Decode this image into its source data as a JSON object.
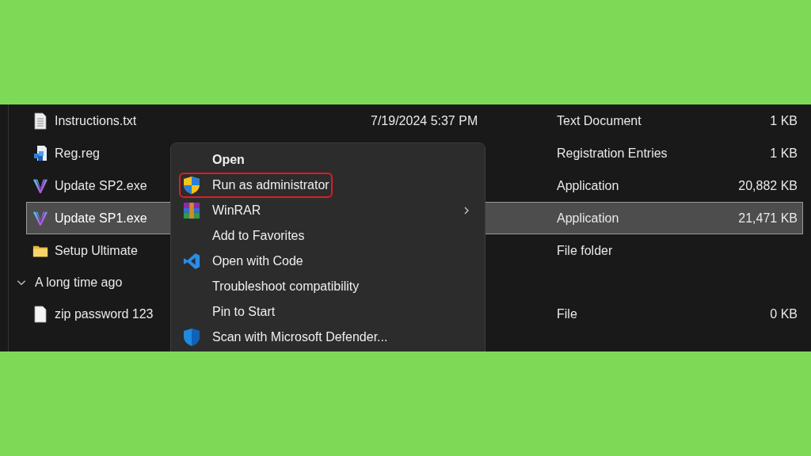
{
  "file_list": {
    "rows": [
      {
        "kind": "document",
        "name": "Instructions.txt",
        "date": "7/19/2024 5:37 PM",
        "type": "Text Document",
        "size": "1 KB",
        "selected": false
      },
      {
        "kind": "registry",
        "name": "Reg.reg",
        "type": "Registration Entries",
        "size": "1 KB",
        "selected": false
      },
      {
        "kind": "application",
        "name": "Update SP2.exe",
        "type": "Application",
        "size": "20,882 KB",
        "selected": false
      },
      {
        "kind": "application",
        "name": "Update SP1.exe",
        "type": "Application",
        "size": "21,471 KB",
        "selected": true
      },
      {
        "kind": "folder",
        "name": "Setup Ultimate",
        "type": "File folder",
        "selected": false
      },
      {
        "kind": "group",
        "name": "A long time ago",
        "expanded": true
      },
      {
        "kind": "file",
        "name": "zip password 123",
        "type": "File",
        "size": "0 KB",
        "selected": false
      }
    ]
  },
  "context_menu": {
    "items": [
      {
        "kind": "plain",
        "label": "Open",
        "default": true,
        "highlighted": false,
        "has_submenu": false
      },
      {
        "kind": "admin-shield",
        "label": "Run as administrator",
        "default": false,
        "highlighted": true,
        "has_submenu": false
      },
      {
        "kind": "archive",
        "label": "WinRAR",
        "default": false,
        "highlighted": false,
        "has_submenu": true
      },
      {
        "kind": "plain",
        "label": "Add to Favorites",
        "default": false,
        "highlighted": false,
        "has_submenu": false
      },
      {
        "kind": "code-editor",
        "label": "Open with Code",
        "default": false,
        "highlighted": false,
        "has_submenu": false
      },
      {
        "kind": "plain",
        "label": "Troubleshoot compatibility",
        "default": false,
        "highlighted": false,
        "has_submenu": false
      },
      {
        "kind": "plain",
        "label": "Pin to Start",
        "default": false,
        "highlighted": false,
        "has_submenu": false
      },
      {
        "kind": "defender-shield",
        "label": "Scan with Microsoft Defender...",
        "default": false,
        "highlighted": false,
        "has_submenu": false
      }
    ]
  }
}
